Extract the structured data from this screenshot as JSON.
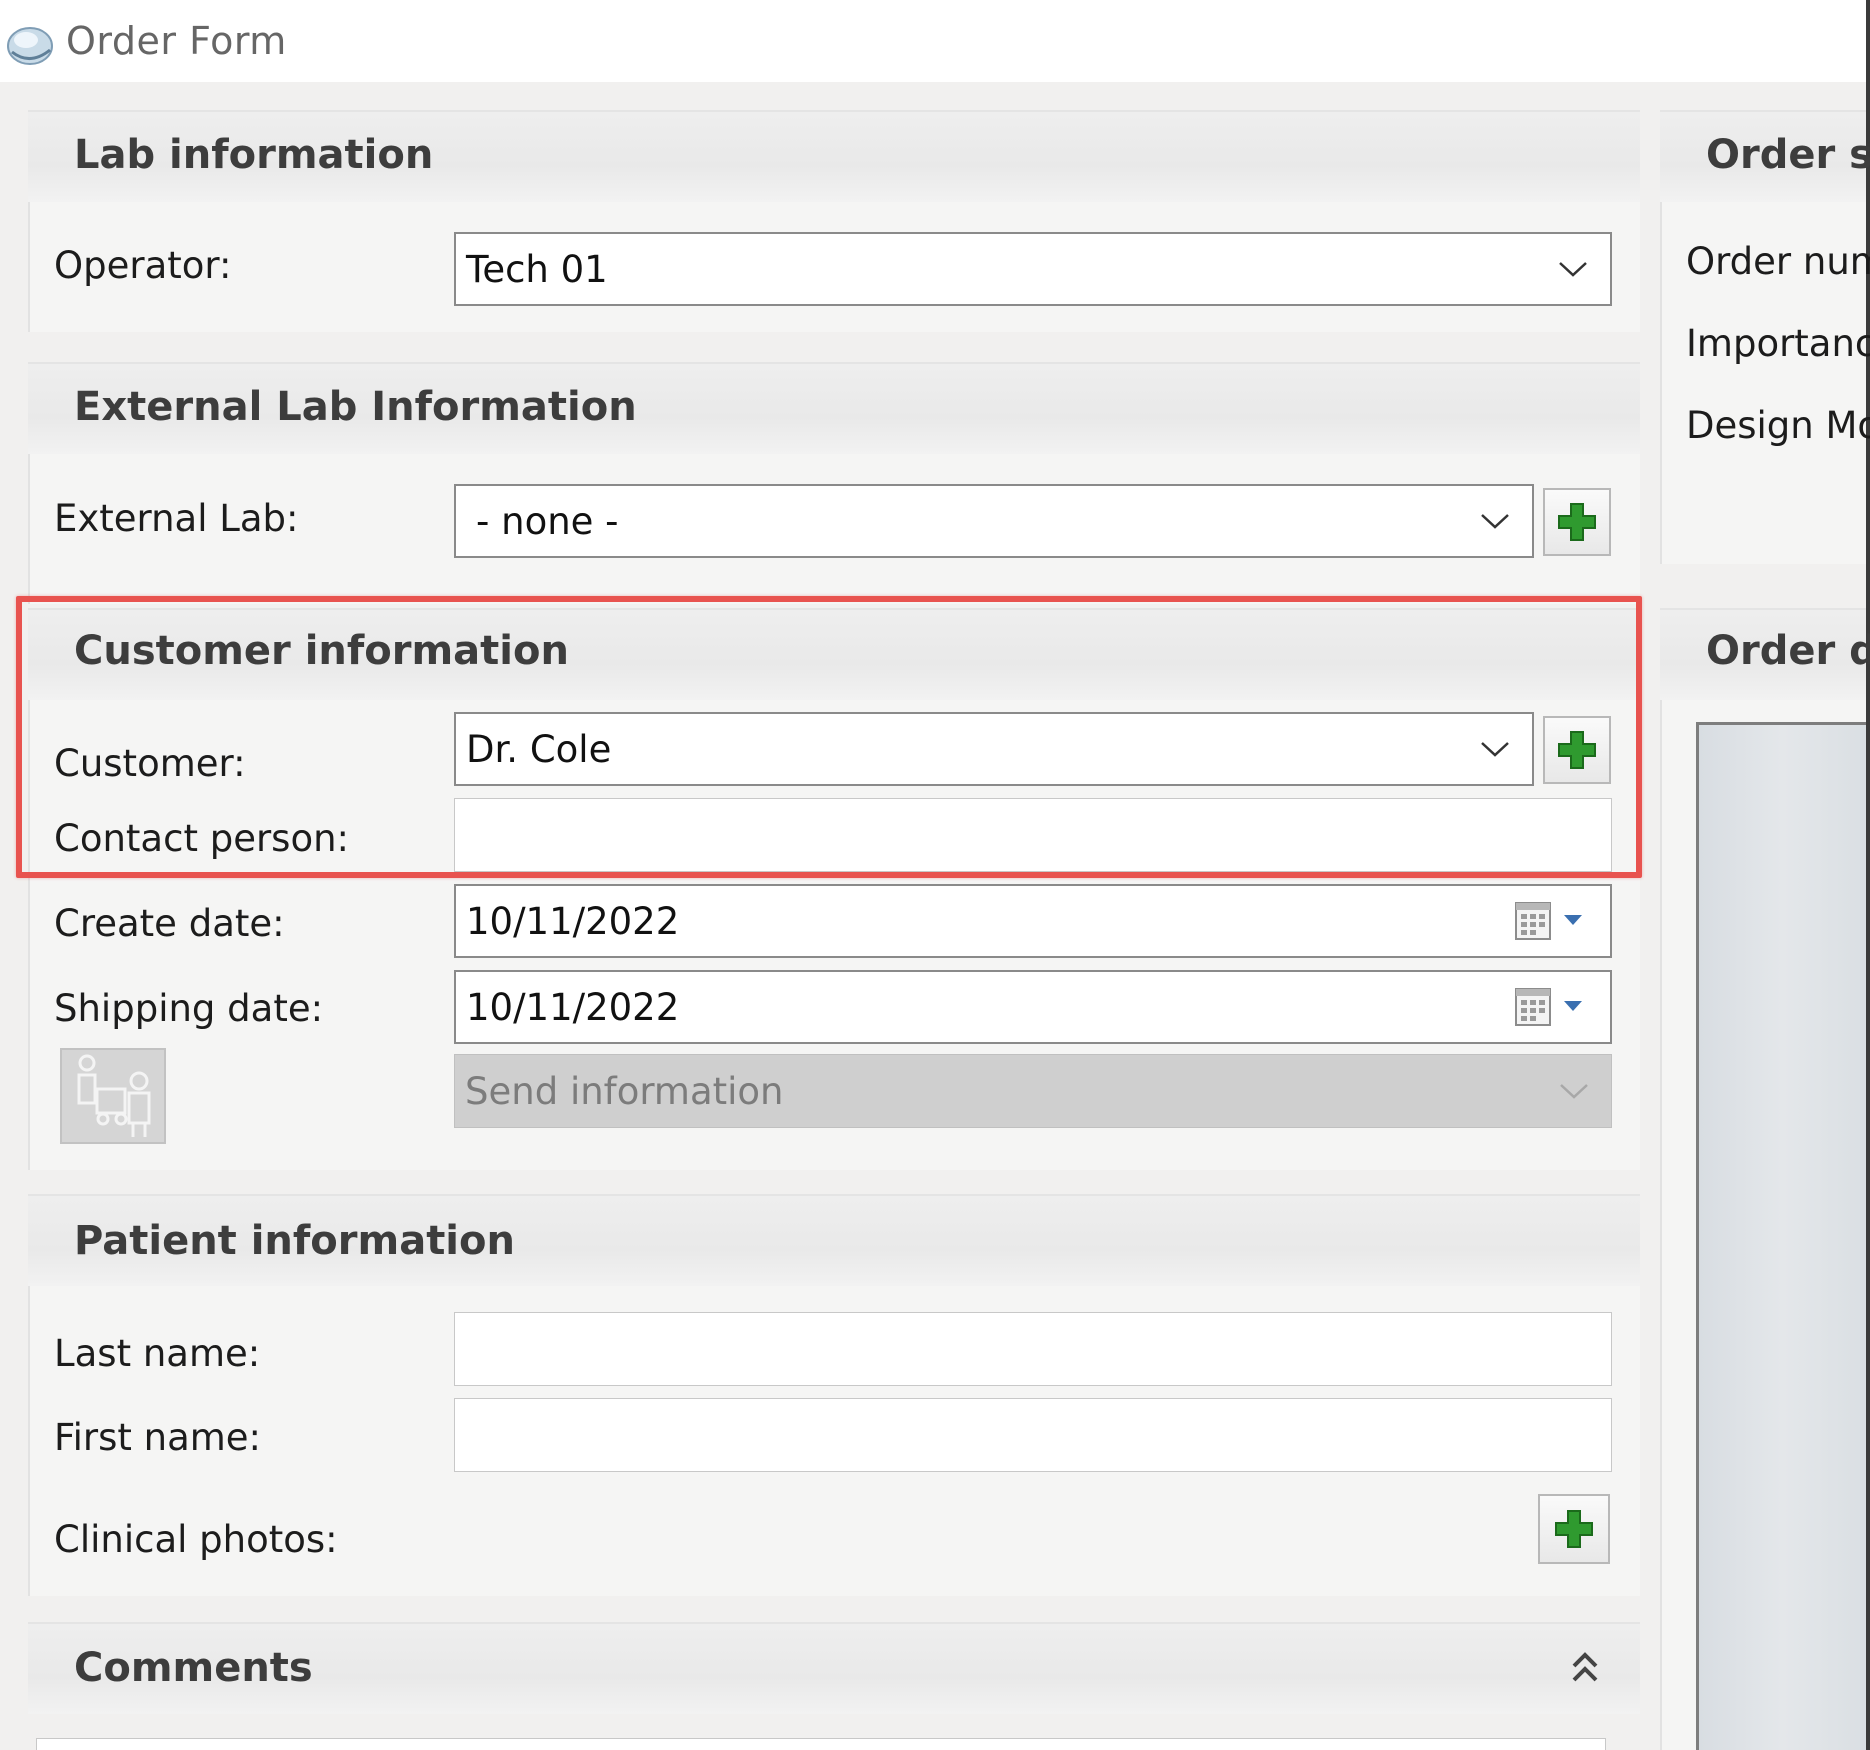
{
  "window": {
    "title": "Order Form"
  },
  "lab_info": {
    "title": "Lab information",
    "operator_label": "Operator:",
    "operator_value": "Tech 01"
  },
  "external_lab": {
    "title": "External Lab Information",
    "external_lab_label": "External Lab:",
    "external_lab_value": "- none -"
  },
  "customer_info": {
    "title": "Customer information",
    "customer_label": "Customer:",
    "customer_value": "Dr. Cole",
    "contact_label": "Contact person:",
    "contact_value": "",
    "create_date_label": "Create date:",
    "create_date_value": "10/11/2022",
    "shipping_date_label": "Shipping date:",
    "shipping_date_value": "10/11/2022",
    "send_info_placeholder": "Send information"
  },
  "patient_info": {
    "title": "Patient information",
    "last_name_label": "Last name:",
    "first_name_label": "First name:",
    "clinical_photos_label": "Clinical photos:"
  },
  "comments": {
    "title": "Comments"
  },
  "order_settings": {
    "title": "Order se",
    "order_number_label": "Order num",
    "importance_label": "Importance",
    "design_mode_label": "Design Moc"
  },
  "order_details": {
    "title": "Order de"
  },
  "colors": {
    "highlight": "#e8534f",
    "plus_green": "#2f9a2f"
  }
}
